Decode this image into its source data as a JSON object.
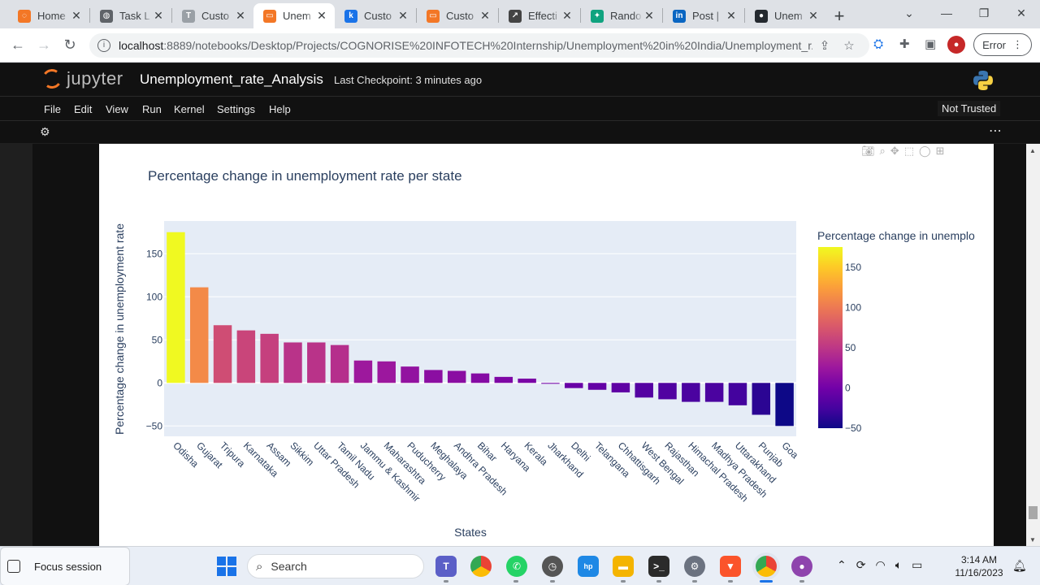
{
  "browser": {
    "tabs": [
      {
        "label": "Home",
        "color": "#f37726",
        "glyph": "◌",
        "active": false
      },
      {
        "label": "Task L",
        "color": "#5f6368",
        "glyph": "◍",
        "active": false
      },
      {
        "label": "Custo",
        "color": "#9aa0a6",
        "glyph": "T",
        "active": false
      },
      {
        "label": "Unem",
        "color": "#f37726",
        "glyph": "▭",
        "active": true
      },
      {
        "label": "Custo",
        "color": "#1a73e8",
        "glyph": "k",
        "active": false
      },
      {
        "label": "Custo",
        "color": "#f37726",
        "glyph": "▭",
        "active": false
      },
      {
        "label": "Effecti",
        "color": "#444444",
        "glyph": "↗",
        "active": false
      },
      {
        "label": "Rando",
        "color": "#10a37f",
        "glyph": "✦",
        "active": false
      },
      {
        "label": "Post |",
        "color": "#0a66c2",
        "glyph": "in",
        "active": false
      },
      {
        "label": "Unem",
        "color": "#24292f",
        "glyph": "●",
        "active": false
      }
    ],
    "url_host": "localhost",
    "url_rest": ":8889/notebooks/Desktop/Projects/COGNORISE%20INFOTECH%20Internship/Unemployment%20in%20India/Unemployment_r...",
    "error_label": "Error"
  },
  "jupyter": {
    "logo_text": "jupyter",
    "notebook_title": "Unemployment_rate_Analysis",
    "checkpoint": "Last Checkpoint: 3 minutes ago",
    "menu": [
      "File",
      "Edit",
      "View",
      "Run",
      "Kernel",
      "Settings",
      "Help"
    ],
    "trust_status": "Not Trusted"
  },
  "chart_data": {
    "type": "bar",
    "title": "Percentage change in unemployment rate per state",
    "xlabel": "States",
    "ylabel": "Percentage change in unemployment rate",
    "colorbar_title": "Percentage change in unemplo",
    "categories": [
      "Odisha",
      "Gujarat",
      "Tripura",
      "Karnataka",
      "Assam",
      "Sikkim",
      "Uttar Pradesh",
      "Tamil Nadu",
      "Jammu & Kashmir",
      "Maharashtra",
      "Puducherry",
      "Meghalaya",
      "Andhra Pradesh",
      "Bihar",
      "Haryana",
      "Kerala",
      "Jharkhand",
      "Delhi",
      "Telangana",
      "Chhattisgarh",
      "West Bengal",
      "Rajasthan",
      "Himachal Pradesh",
      "Madhya Pradesh",
      "Uttarakhand",
      "Punjab",
      "Goa"
    ],
    "values": [
      175,
      111,
      67,
      61,
      57,
      47,
      47,
      44,
      26,
      25,
      19,
      15,
      14,
      11,
      7,
      5,
      -1,
      -6,
      -8,
      -11,
      -17,
      -19,
      -22,
      -22,
      -26,
      -37,
      -50
    ],
    "ylim": [
      -62,
      188
    ],
    "yticks": [
      -50,
      0,
      50,
      100,
      150
    ],
    "colorbar_ticks": [
      -50,
      0,
      50,
      100,
      150
    ],
    "color_range": [
      -50,
      175
    ],
    "grid": true,
    "plot_bg": "#e5ecf6"
  },
  "taskbar": {
    "focus_label": "Focus session",
    "search_placeholder": "Search",
    "time": "3:14 AM",
    "date": "11/16/2023"
  }
}
